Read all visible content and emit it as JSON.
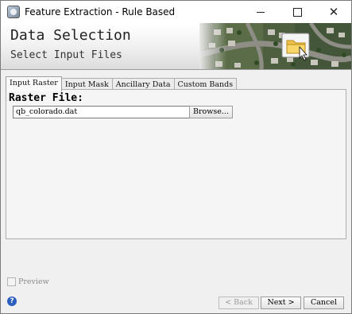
{
  "window": {
    "title": "Feature Extraction - Rule Based",
    "minimize_icon": "minimize-icon",
    "maximize_icon": "maximize-icon",
    "close_icon": "close-icon"
  },
  "header": {
    "title": "Data Selection",
    "subtitle": "Select Input Files",
    "image_icon": "folder-icon"
  },
  "tabs": [
    {
      "label": "Input Raster",
      "active": true
    },
    {
      "label": "Input Mask",
      "active": false
    },
    {
      "label": "Ancillary Data",
      "active": false
    },
    {
      "label": "Custom Bands",
      "active": false
    }
  ],
  "input_raster": {
    "label": "Raster File:",
    "file_value": "qb_colorado.dat",
    "browse_label": "Browse..."
  },
  "footer": {
    "preview_label": "Preview",
    "preview_checked": false,
    "help_icon": "help-icon",
    "back_label": "< Back",
    "next_label": "Next >",
    "cancel_label": "Cancel"
  }
}
